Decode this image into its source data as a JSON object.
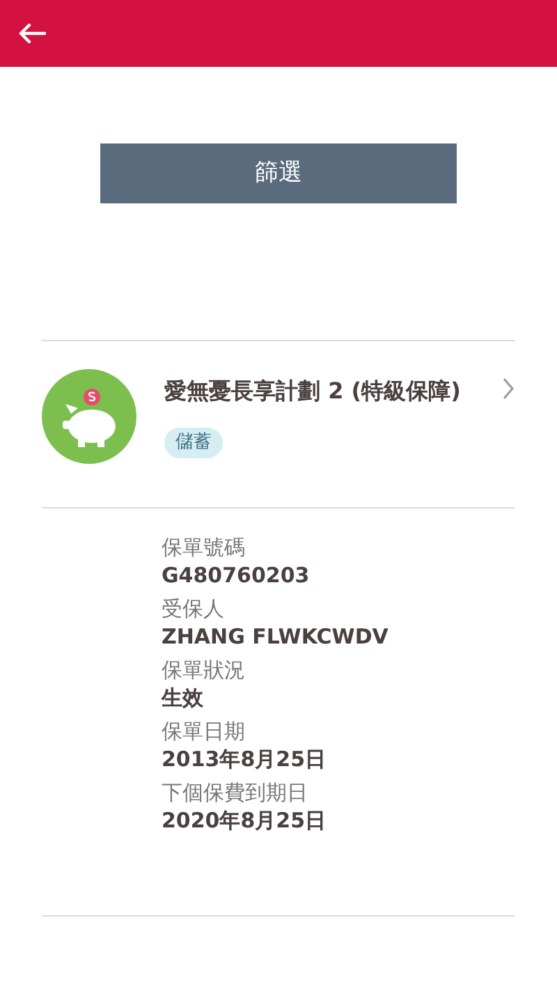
{
  "filter_button": {
    "label": "篩選"
  },
  "policy": {
    "title": "愛無憂長享計劃 2 (特級保障)",
    "tag": "儲蓄",
    "fields": [
      {
        "label": "保單號碼",
        "value": "G480760203"
      },
      {
        "label": "受保人",
        "value": "ZHANG FLWKCWDV"
      },
      {
        "label": "保單狀況",
        "value": "生效"
      },
      {
        "label": "保單日期",
        "value": "2013年8月25日"
      },
      {
        "label": "下個保費到期日",
        "value": "2020年8月25日"
      }
    ]
  }
}
